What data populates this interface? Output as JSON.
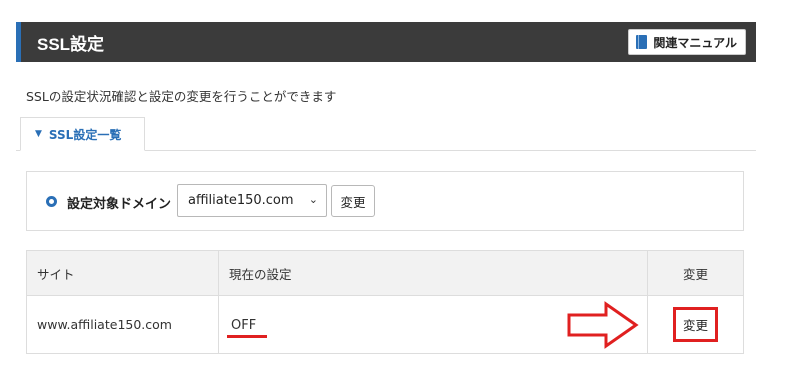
{
  "header": {
    "title": "SSL設定",
    "manual_button": "関連マニュアル",
    "accent_color": "#2a6fb6",
    "bar_color": "#3b3b3b"
  },
  "description": "SSLの設定状況確認と設定の変更を行うことができます",
  "tab": {
    "label": "SSL設定一覧",
    "icon": "chevron-down-icon"
  },
  "domain_selector": {
    "label": "設定対象ドメイン",
    "selected": "affiliate150.com",
    "button": "変更"
  },
  "table": {
    "columns": [
      "サイト",
      "現在の設定",
      "変更"
    ],
    "rows": [
      {
        "site": "www.affiliate150.com",
        "status": "OFF",
        "action": "変更"
      }
    ]
  },
  "annotation_color": "#e02020"
}
